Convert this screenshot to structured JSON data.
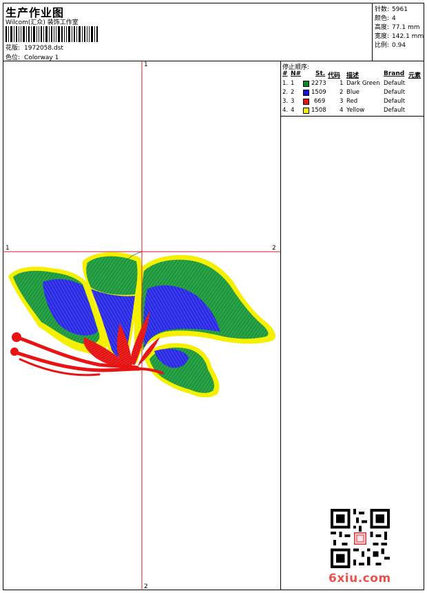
{
  "header": {
    "title": "生产作业图",
    "company": "Wilcom(汇众) 装饰工作室",
    "design_label": "花版:",
    "design_value": "1972058.dst",
    "colorway_label": "色位:",
    "colorway_value": "Colorway 1"
  },
  "stats": [
    {
      "label": "针数:",
      "value": "5961"
    },
    {
      "label": "颜色:",
      "value": "4"
    },
    {
      "label": "高度:",
      "value": "77.1 mm"
    },
    {
      "label": "宽度:",
      "value": "142.1 mm"
    },
    {
      "label": "比例:",
      "value": "0.94"
    }
  ],
  "legend": {
    "title": "停止顺序:",
    "headers": {
      "idx": "#",
      "no": "N#",
      "st": "St.",
      "code": "代码",
      "desc": "描述",
      "brand": "Brand",
      "elem": "元素"
    },
    "rows": [
      {
        "idx": "1.",
        "no": "1",
        "color": "#0a8a22",
        "st": "2273",
        "code": "1",
        "desc": "Dark Green",
        "brand": "Default"
      },
      {
        "idx": "2.",
        "no": "2",
        "color": "#1515e0",
        "st": "1509",
        "code": "2",
        "desc": "Blue",
        "brand": "Default"
      },
      {
        "idx": "3.",
        "no": "3",
        "color": "#e81414",
        "st": "669",
        "code": "3",
        "desc": "Red",
        "brand": "Default"
      },
      {
        "idx": "4.",
        "no": "4",
        "color": "#f5f000",
        "st": "1508",
        "code": "4",
        "desc": "Yellow",
        "brand": "Default"
      }
    ]
  },
  "axes": {
    "top": "1",
    "bottom": "2",
    "left": "1",
    "right": "2"
  },
  "watermark": "6xiu.com",
  "colors": {
    "green": "#0a8a22",
    "blue": "#1515e0",
    "red": "#e81414",
    "yellow": "#f5f000",
    "axis": "#d21e1e"
  }
}
